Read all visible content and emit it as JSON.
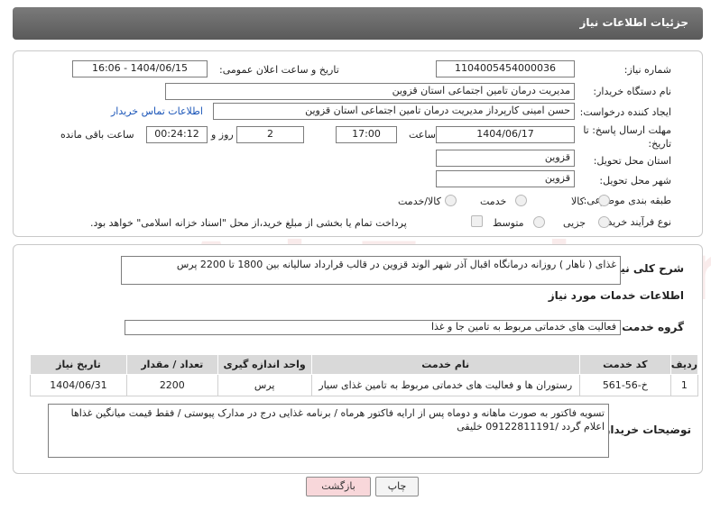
{
  "header": {
    "title": "جزئیات اطلاعات نیاز"
  },
  "labels": {
    "need_number": "شماره نیاز:",
    "announce_datetime": "تاریخ و ساعت اعلان عمومی:",
    "buyer_org": "نام دستگاه خریدار:",
    "requester": "ایجاد کننده درخواست:",
    "contact_info": "اطلاعات تماس خریدار",
    "deadline": "مهلت ارسال پاسخ: تا تاریخ:",
    "hour": "ساعت",
    "day_and": "روز و",
    "remaining": "ساعت باقی مانده",
    "province": "استان محل تحویل:",
    "city": "شهر محل تحویل:",
    "category": "طبقه بندی موضوعی:",
    "process_type": "نوع فرآیند خرید :",
    "general_desc": "شرح کلی نیاز:",
    "services_info": "اطلاعات خدمات مورد نیاز",
    "service_group": "گروه خدمت:",
    "buyer_notes": "توضیحات خریدار:"
  },
  "values": {
    "need_number": "1104005454000036",
    "announce_datetime": "1404/06/15 - 16:06",
    "buyer_org": "مدیریت درمان تامین اجتماعی استان قزوین",
    "requester": "حسن امینی کارپرداز مدیریت درمان تامین اجتماعی استان قزوین",
    "deadline_date": "1404/06/17",
    "deadline_time": "17:00",
    "days": "2",
    "remaining_time": "00:24:12",
    "province": "قزوین",
    "city": "قزوین",
    "general_desc": "غذای ( ناهار ) روزانه درمانگاه اقبال آذر شهر الوند قزوین در قالب قرارداد سالیانه بین 1800 تا 2200 پرس",
    "service_group": "فعالیت های خدماتی مربوط به تامین جا و غذا",
    "buyer_notes": "تسویه فاکتور به صورت ماهانه و دوماه پس از ارایه فاکتور هرماه / برنامه غذایی درج در مدارک پیوستی / فقط قیمت میانگین غذاها اعلام گردد /09122811191 خلیقی"
  },
  "category_options": [
    "کالا",
    "خدمت",
    "کالا/خدمت"
  ],
  "process_options": [
    "جزیی",
    "متوسط"
  ],
  "payment_note": "پرداخت تمام یا بخشی از مبلغ خرید،از محل \"اسناد خزانه اسلامی\" خواهد بود.",
  "table": {
    "headers": [
      "ردیف",
      "کد خدمت",
      "نام خدمت",
      "واحد اندازه گیری",
      "تعداد / مقدار",
      "تاریخ نیاز"
    ],
    "rows": [
      [
        "1",
        "خ-56-561",
        "رستوران ها و فعالیت های خدماتی مربوط به تامین غذای سیار",
        "پرس",
        "2200",
        "1404/06/31"
      ]
    ]
  },
  "buttons": {
    "print": "چاپ",
    "back": "بازگشت"
  },
  "watermark": "AriaTender.neT",
  "colors": {
    "header": "#6b6b6b",
    "link": "#1a55b8",
    "back_button": "#f8d7da"
  }
}
